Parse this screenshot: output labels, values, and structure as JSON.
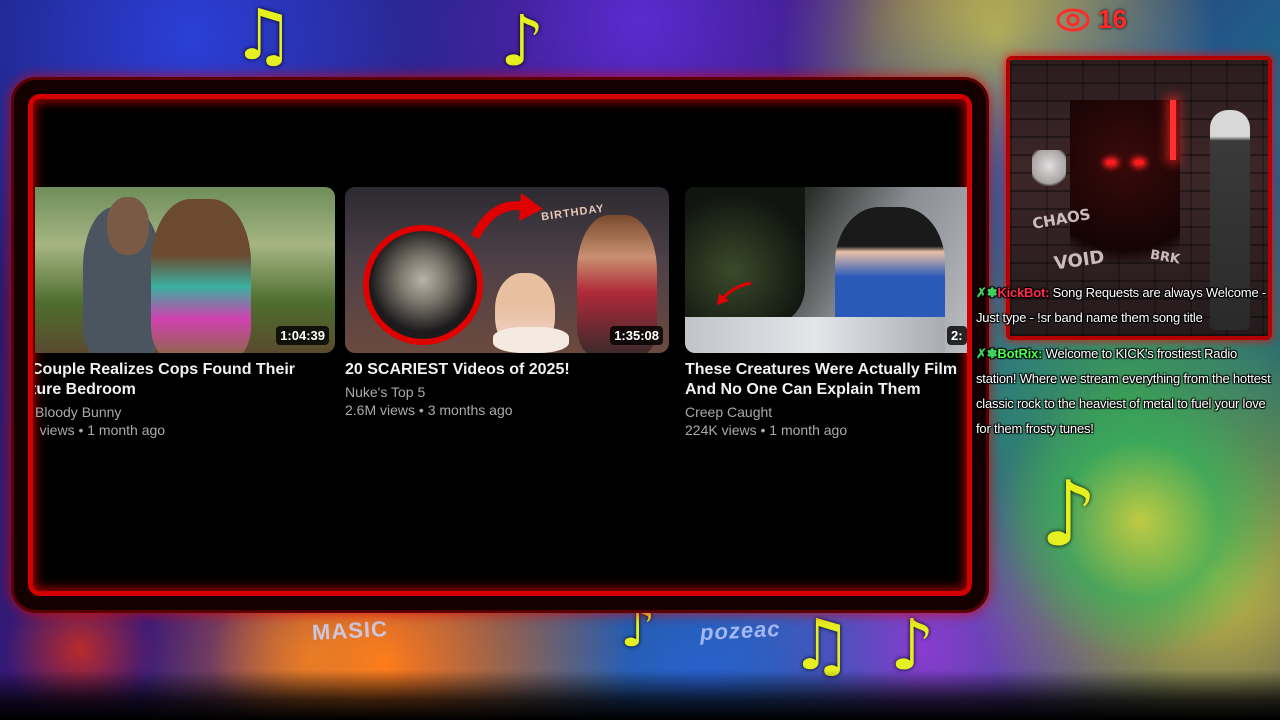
{
  "overlay": {
    "viewer_count": "16",
    "bg_words": [
      "MASIC",
      "pozeac"
    ]
  },
  "videos": [
    {
      "title": "Couple Realizes Cops Found Their\nture Bedroom",
      "channel": "Bloody Bunny",
      "meta": "' views • 1 month ago",
      "duration": "1:04:39"
    },
    {
      "title": "20 SCARIEST Videos of 2025!",
      "channel": "Nuke's Top 5",
      "meta": "2.6M views • 3 months ago",
      "duration": "1:35:08",
      "thumb_text": "BIRTHDAY"
    },
    {
      "title": "These Creatures Were Actually Film\nAnd No One Can Explain Them",
      "channel": "Creep Caught",
      "meta": "224K views • 1 month ago",
      "duration": "2:"
    }
  ],
  "preview": {
    "tags": [
      "CHAOS",
      "VOID",
      "BRK"
    ]
  },
  "chat": [
    {
      "username": "KickBot:",
      "message": "Song Requests are always Welcome - Just type - !sr band name them song title"
    },
    {
      "username": "BotRix:",
      "message": "Welcome to KICK's frostiest Radio station! Where we stream everything from the hottest classic rock to the heaviest of metal to fuel your love for them frosty tunes!"
    }
  ],
  "colors": {
    "frame_red": "#d40000",
    "kick_name": "#ff2d4a",
    "botrix_name": "#4cff4c",
    "viewer_red": "#ff2b2b"
  }
}
